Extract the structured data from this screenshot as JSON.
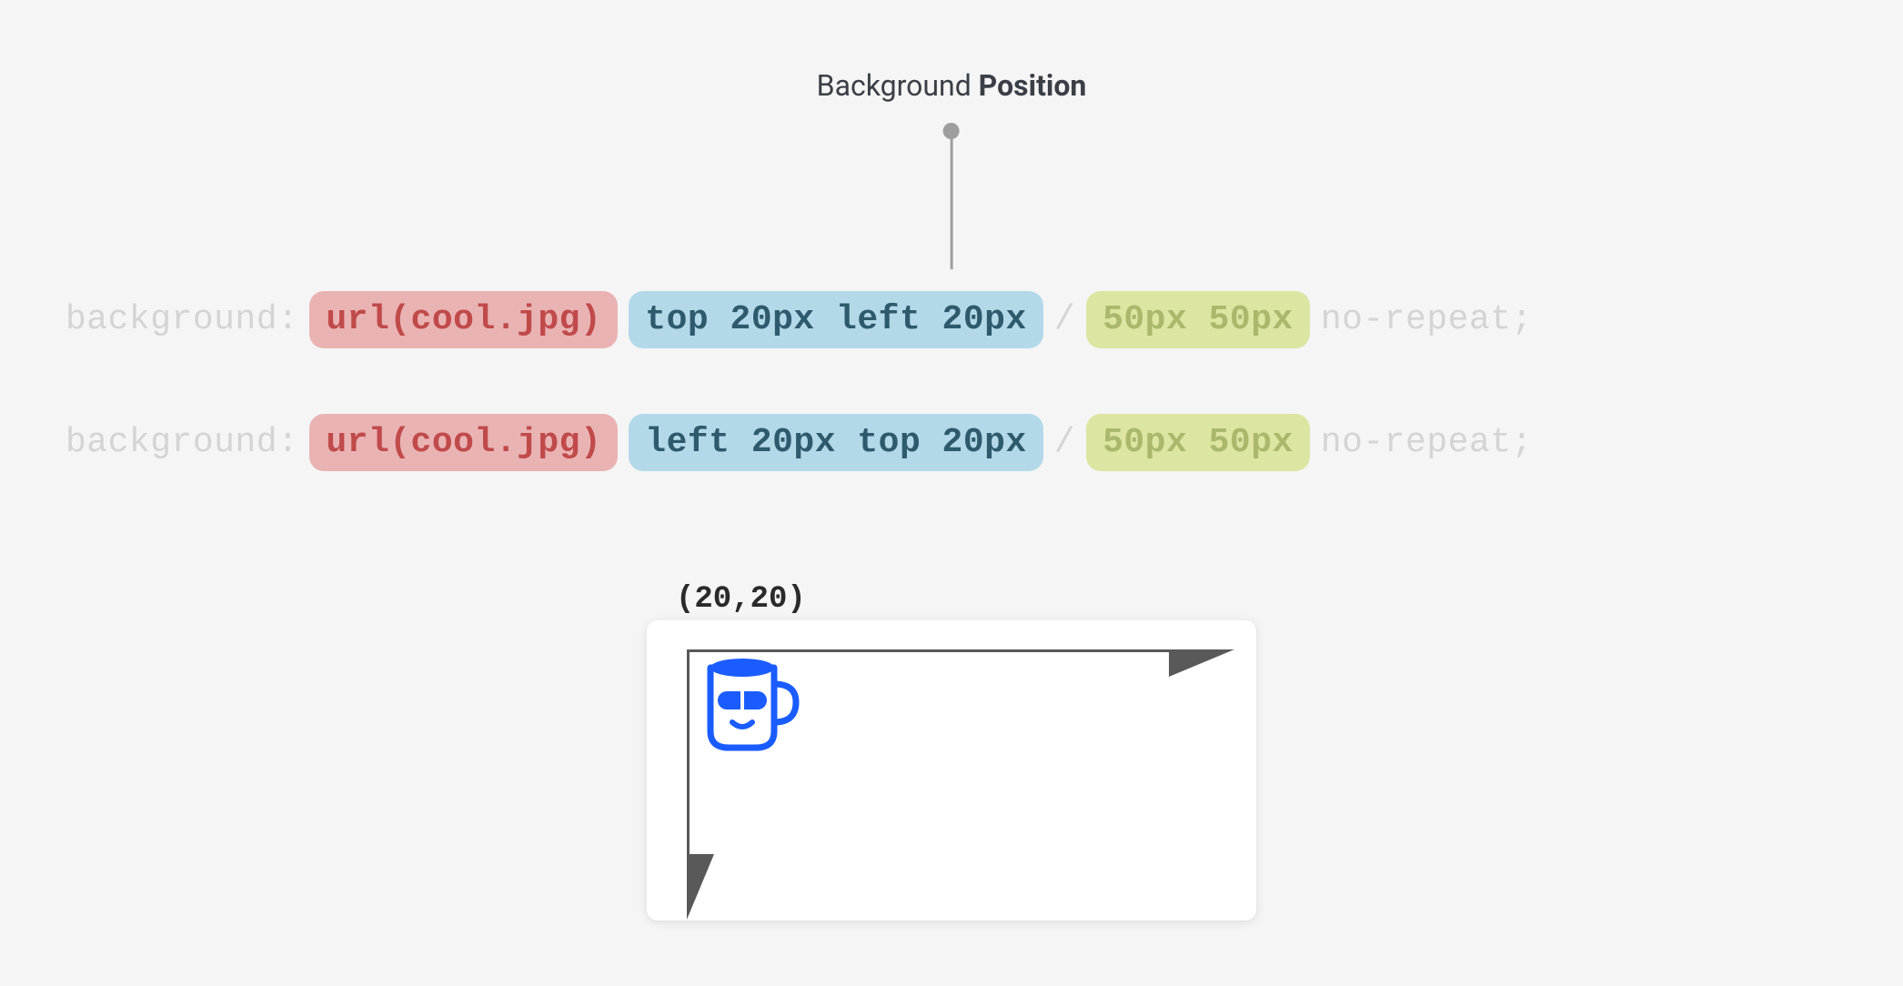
{
  "title": {
    "prefix": "Background ",
    "bold": "Position"
  },
  "lines": [
    {
      "property": "background:",
      "url": "url(cool.jpg)",
      "position": "top 20px left 20px",
      "separator": "/",
      "size": "50px 50px",
      "repeat": "no-repeat;"
    },
    {
      "property": "background:",
      "url": "url(cool.jpg)",
      "position": "left 20px top 20px",
      "separator": "/",
      "size": "50px 50px",
      "repeat": "no-repeat;"
    }
  ],
  "preview": {
    "coordinate": "(20,20)"
  }
}
